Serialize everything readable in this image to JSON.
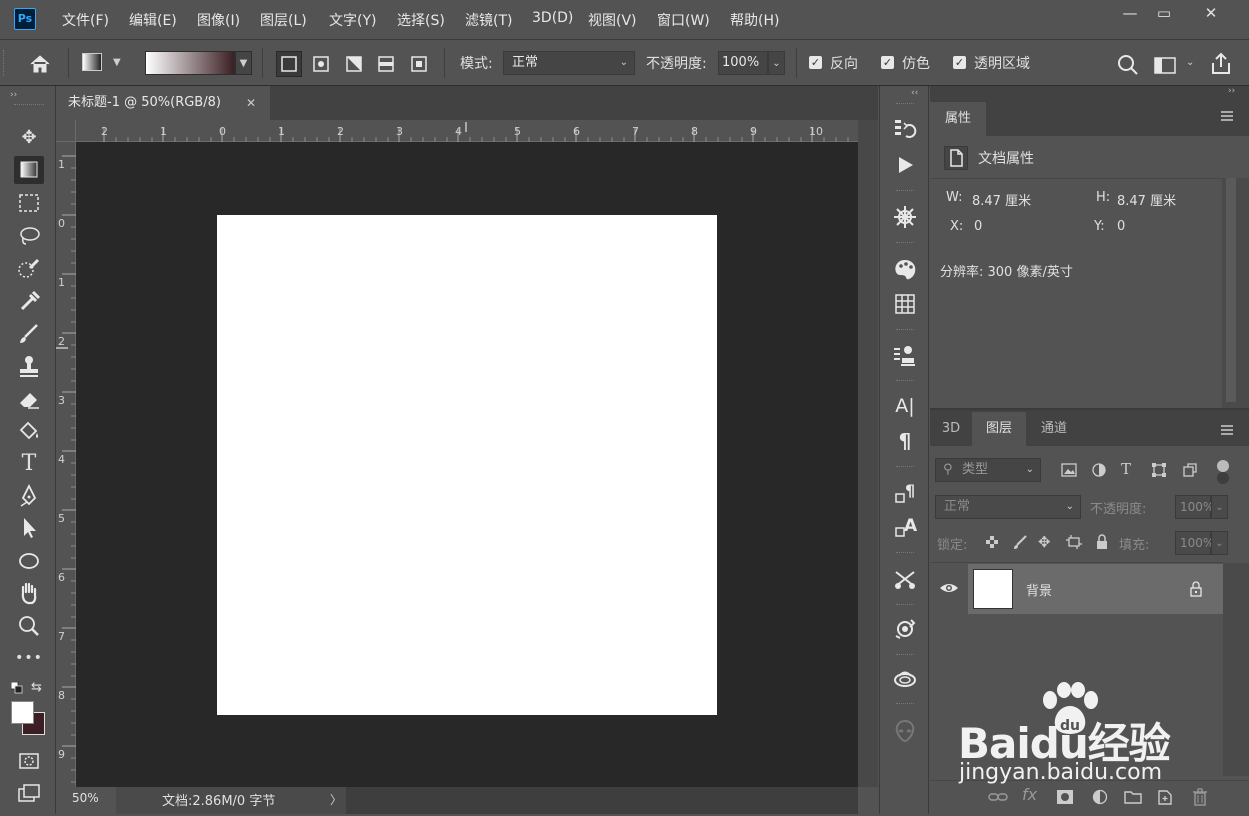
{
  "app": {
    "logo": "Ps"
  },
  "menu": [
    "文件(F)",
    "编辑(E)",
    "图像(I)",
    "图层(L)",
    "文字(Y)",
    "选择(S)",
    "滤镜(T)",
    "3D(D)",
    "视图(V)",
    "窗口(W)",
    "帮助(H)"
  ],
  "window": {
    "minimize": "—",
    "maximize": "▭",
    "close": "✕"
  },
  "options": {
    "mode_label": "模式:",
    "mode_value": "正常",
    "opacity_label": "不透明度:",
    "opacity_value": "100%",
    "reverse_label": "反向",
    "dither_label": "仿色",
    "transparency_label": "透明区域"
  },
  "document": {
    "tab_title": "未标题-1 @ 50%(RGB/8)",
    "close": "✕",
    "zoom": "50%",
    "status": "文档:2.86M/0 字节",
    "status_arrow": "〉"
  },
  "ruler": {
    "top": [
      "2",
      "1",
      "0",
      "1",
      "2",
      "3",
      "4",
      "5",
      "6",
      "7",
      "8",
      "9",
      "10"
    ],
    "left": [
      "1",
      "0",
      "1",
      "2",
      "3",
      "4",
      "5",
      "6",
      "7",
      "8",
      "9"
    ]
  },
  "properties": {
    "tab": "属性",
    "doc_props": "文档属性",
    "w_label": "W:",
    "w_value": "8.47 厘米",
    "h_label": "H:",
    "h_value": "8.47 厘米",
    "x_label": "X:",
    "x_value": "0",
    "y_label": "Y:",
    "y_value": "0",
    "resolution": "分辨率: 300 像素/英寸"
  },
  "layers": {
    "tabs": [
      "3D",
      "图层",
      "通道"
    ],
    "filter_label": "类型",
    "blend": "正常",
    "opacity_label": "不透明度:",
    "opacity_value": "100%",
    "lock_label": "锁定:",
    "fill_label": "填充:",
    "fill_value": "100%",
    "layer_name": "背景"
  },
  "watermark": {
    "brand": "Baidu经验",
    "url": "jingyan.baidu.com"
  },
  "colors": {
    "bg": "#535353",
    "canvas": "#282828",
    "accent": "#31a8ff",
    "bg_color_swatch": "#3b1f24"
  }
}
